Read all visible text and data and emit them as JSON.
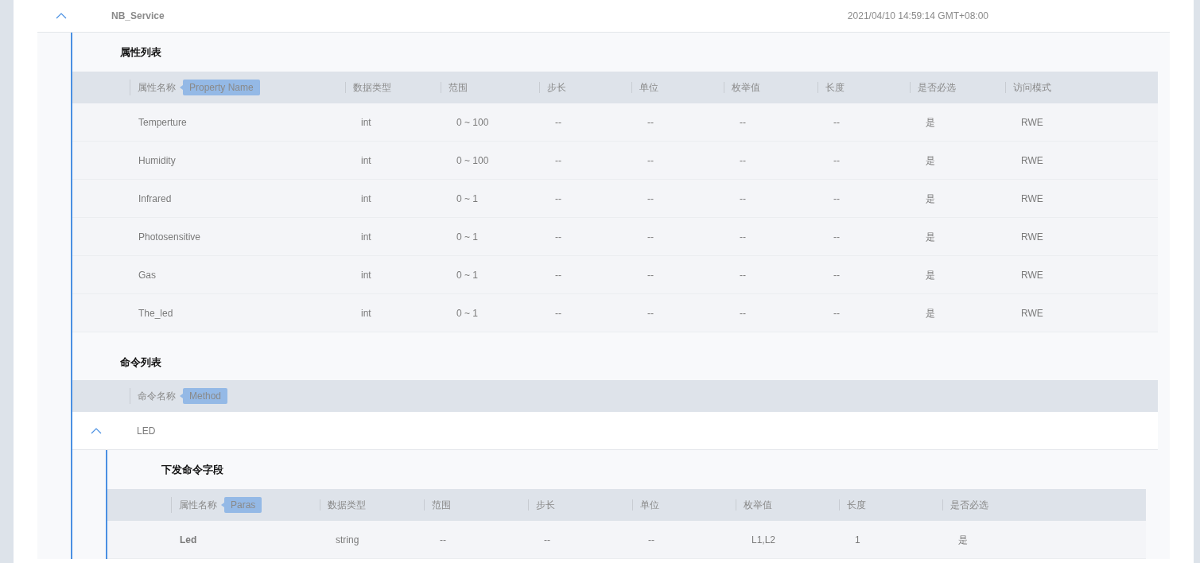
{
  "service": {
    "name": "NB_Service",
    "timestamp": "2021/04/10 14:59:14 GMT+08:00",
    "expanded": true
  },
  "property_list": {
    "title": "属性列表",
    "columns": [
      "属性名称",
      "数据类型",
      "范围",
      "步长",
      "单位",
      "枚举值",
      "长度",
      "是否必选",
      "访问模式"
    ],
    "tag": "Property Name",
    "rows": [
      [
        "Temperture",
        "int",
        "0 ~ 100",
        "--",
        "--",
        "--",
        "--",
        "是",
        "RWE"
      ],
      [
        "Humidity",
        "int",
        "0 ~ 100",
        "--",
        "--",
        "--",
        "--",
        "是",
        "RWE"
      ],
      [
        "Infrared",
        "int",
        "0 ~ 1",
        "--",
        "--",
        "--",
        "--",
        "是",
        "RWE"
      ],
      [
        "Photosensitive",
        "int",
        "0 ~ 1",
        "--",
        "--",
        "--",
        "--",
        "是",
        "RWE"
      ],
      [
        "Gas",
        "int",
        "0 ~ 1",
        "--",
        "--",
        "--",
        "--",
        "是",
        "RWE"
      ],
      [
        "The_led",
        "int",
        "0 ~ 1",
        "--",
        "--",
        "--",
        "--",
        "是",
        "RWE"
      ]
    ]
  },
  "command_list": {
    "title": "命令列表",
    "column": "命令名称",
    "tag": "Method",
    "commands": [
      {
        "name": "LED",
        "expanded": true,
        "fields_title": "下发命令字段",
        "columns": [
          "属性名称",
          "数据类型",
          "范围",
          "步长",
          "单位",
          "枚举值",
          "长度",
          "是否必选"
        ],
        "tag": "Paras",
        "rows": [
          [
            "Led",
            "string",
            "--",
            "--",
            "--",
            "L1,L2",
            "1",
            "是"
          ]
        ]
      }
    ]
  }
}
